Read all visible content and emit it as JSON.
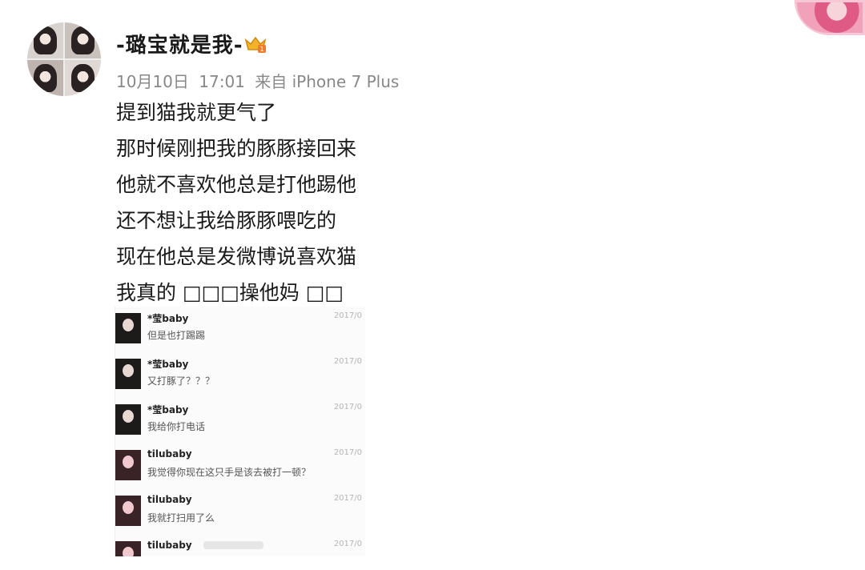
{
  "post": {
    "username": "-璐宝就是我-",
    "date": "10月10日",
    "time": "17:01",
    "source": "来自 iPhone 7 Plus",
    "lines": [
      "提到猫我就更气了",
      "那时候刚把我的豚豚接回来",
      "他就不喜欢他总是打他踢他",
      "还不想让我给豚豚喂吃的",
      "现在他总是发微博说喜欢猫",
      "我真的 □□□操他妈 □□"
    ]
  },
  "chat": {
    "rows": [
      {
        "name": "*莹baby",
        "time": "2017/0",
        "message": "但是也打踢踢"
      },
      {
        "name": "*莹baby",
        "time": "2017/0",
        "message": "又打豚了？？？"
      },
      {
        "name": "*莹baby",
        "time": "2017/0",
        "message": "我给你打电话"
      },
      {
        "name": "tilubaby",
        "time": "2017/0",
        "message": "我觉得你现在这只手是该去被打一顿？"
      },
      {
        "name": "tilubaby",
        "time": "2017/0",
        "message": "我就打扫用了么"
      },
      {
        "name": "tilubaby",
        "time": "2017/0",
        "message": ""
      }
    ]
  },
  "icons": {
    "vip": "vip-crown-icon"
  }
}
